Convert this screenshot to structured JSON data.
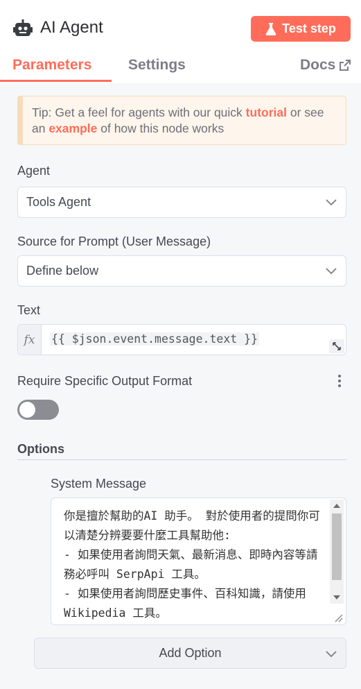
{
  "header": {
    "title": "AI Agent",
    "test_step_label": "Test step",
    "accent_color": "#ff6d5a"
  },
  "tabs": {
    "parameters": "Parameters",
    "settings": "Settings",
    "docs": "Docs",
    "active": "Parameters"
  },
  "tip": {
    "prefix": "Tip: Get a feel for agents with our quick ",
    "link1": "tutorial",
    "middle": " or see an ",
    "link2": "example",
    "suffix": " of how this node works"
  },
  "agent": {
    "label": "Agent",
    "value": "Tools Agent"
  },
  "prompt_source": {
    "label": "Source for Prompt (User Message)",
    "value": "Define below"
  },
  "text_field": {
    "label": "Text",
    "fx": "fx",
    "expression": "{{ $json.event.message.text }}"
  },
  "output_format": {
    "label": "Require Specific Output Format",
    "enabled": false
  },
  "options": {
    "label": "Options",
    "system_message_label": "System Message",
    "system_message": "你是擅於幫助的AI 助手。 對於使用者的提問你可以清楚分辨要要什麼工具幫助他:\n- 如果使用者詢問天氣、最新消息、即時內容等請務必呼叫 SerpApi 工具。\n- 如果使用者詢問歷史事件、百科知識，請使用 Wikipedia 工具。\n- 請以 zh-tw 給予回應",
    "add_option_label": "Add Option"
  },
  "icons": {
    "node": "robot-icon",
    "test": "flask-icon",
    "docs": "external-link-icon",
    "dropdown": "chevron-down-icon",
    "expand": "expand-icon",
    "menu": "kebab-menu-icon"
  }
}
